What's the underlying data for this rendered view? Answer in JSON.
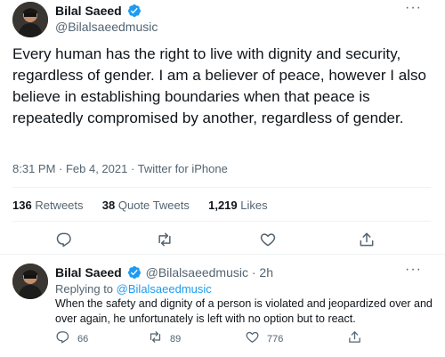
{
  "tweet": {
    "author_name": "Bilal Saeed",
    "author_handle": "@Bilalsaeedmusic",
    "more_label": "···",
    "text": "Every human has the right to live with dignity and security, regardless of gender. I am a believer of peace, however I also believe in establishing boundaries when that peace is repeatedly compromised by another, regardless of gender.",
    "timestamp": "8:31 PM · Feb 4, 2021 · Twitter for iPhone",
    "retweets_count": "136",
    "retweets_label": "Retweets",
    "quote_count": "38",
    "quote_label": "Quote Tweets",
    "likes_count": "1,219",
    "likes_label": "Likes"
  },
  "reply": {
    "author_name": "Bilal Saeed",
    "author_handle": "@Bilalsaeedmusic · 2h",
    "more_label": "···",
    "replying_prefix": "Replying to",
    "replying_to": "@Bilalsaeedmusic",
    "text": "When the safety and dignity of a person is violated and jeopardized over and over again, he unfortunately is left with no option but to react.",
    "reply_count": "66",
    "retweet_count": "89",
    "like_count": "776"
  },
  "colors": {
    "accent": "#1d9bf0",
    "secondary_text": "#536471",
    "divider": "#eff3f4"
  },
  "icons": [
    "verified-badge-icon",
    "more-icon",
    "reply-icon",
    "retweet-icon",
    "like-icon",
    "share-icon"
  ]
}
